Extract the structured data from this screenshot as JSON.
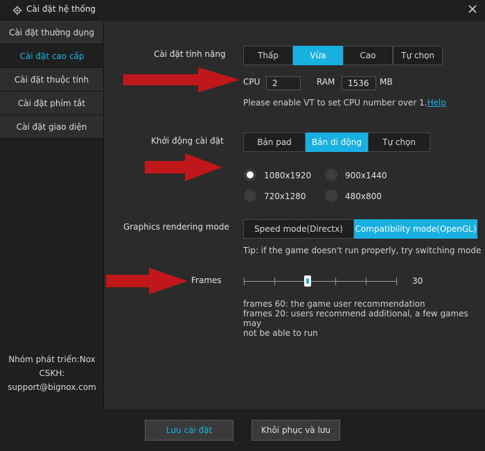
{
  "window": {
    "title": "Cài đặt hệ thống"
  },
  "sidebar": {
    "items": [
      {
        "label": "Cài đặt thường dụng"
      },
      {
        "label": "Cài đặt cao cấp"
      },
      {
        "label": "Cài đặt thuộc tính"
      },
      {
        "label": "Cài đặt phím tắt"
      },
      {
        "label": "Cài đặt giao diện"
      }
    ],
    "footer": {
      "line1": "Nhóm phát triển:Nox",
      "line2": "CSKH:",
      "line3": "support@bignox.com"
    }
  },
  "performance": {
    "label": "Cài đặt tính năng",
    "options": [
      "Thấp",
      "Vừa",
      "Cao",
      "Tự chọn"
    ],
    "selected": "Vừa",
    "cpu_label": "CPU",
    "cpu_value": "2",
    "ram_label": "RAM",
    "ram_value": "1536",
    "ram_unit": "MB",
    "note_prefix": "Please enable VT to set CPU number over 1.",
    "note_link": "Help"
  },
  "startup": {
    "label": "Khởi động cài đặt",
    "options": [
      "Bản pad",
      "Bản di động",
      "Tự chọn"
    ],
    "selected": "Bản di động",
    "resolutions": [
      "1080x1920",
      "900x1440",
      "720x1280",
      "480x800"
    ],
    "selected_resolution": "1080x1920"
  },
  "graphics": {
    "label": "Graphics rendering mode",
    "options": [
      "Speed mode(Directx)",
      "Compatibility mode(OpenGL)"
    ],
    "selected": "Compatibility mode(OpenGL)",
    "tip": "Tip: if the game doesn't run properly, try switching mode"
  },
  "frames": {
    "label": "Frames",
    "value": "30",
    "ticks": 6,
    "selected_index": 2,
    "note1": "frames 60: the game user recommendation",
    "note2": "frames 20: users recommend additional, a few games may",
    "note3": "not be able to run"
  },
  "buttons": {
    "save": "Lưu cài đặt",
    "restore": "Khôi phục và lưu"
  },
  "colors": {
    "accent": "#17b0e0",
    "arrow": "#c0171b"
  }
}
